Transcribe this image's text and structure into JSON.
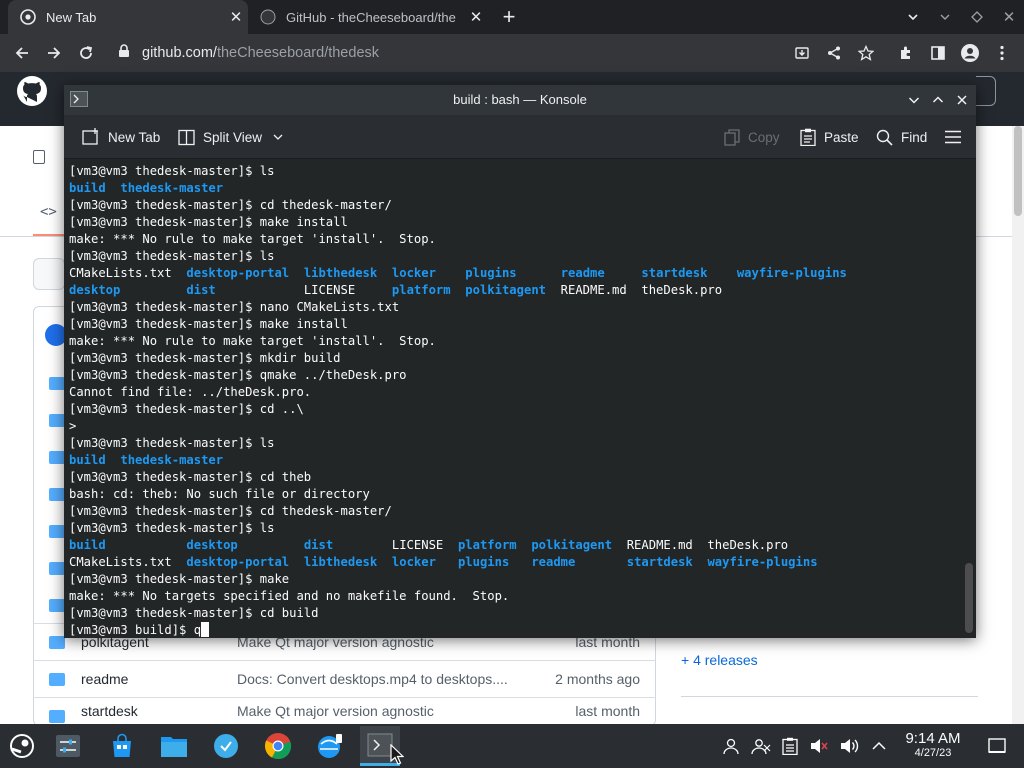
{
  "browser": {
    "tabs": [
      {
        "title": "New Tab",
        "active": true
      },
      {
        "title": "GitHub - theCheeseboard/the",
        "active": false
      }
    ],
    "url_host": "github.com/",
    "url_path": "theCheeseboard/thedesk",
    "new_tab_symbol": "+"
  },
  "github": {
    "files": [
      {
        "name": "polkitagent",
        "message": "Make Qt major version agnostic",
        "time": "last month"
      },
      {
        "name": "readme",
        "message": "Docs: Convert desktops.mp4 to desktops....",
        "time": "2 months ago"
      },
      {
        "name": "startdesk",
        "message": "Make Qt major version agnostic",
        "time": "last month"
      }
    ],
    "releases_link": "+ 4 releases"
  },
  "konsole": {
    "title": "build : bash — Konsole",
    "toolbar": {
      "new_tab": "New Tab",
      "split_view": "Split View",
      "copy": "Copy",
      "paste": "Paste",
      "find": "Find"
    },
    "lines": [
      [
        [
          "[vm3@vm3 thedesk-master]$ ls",
          "n"
        ]
      ],
      [
        [
          "build  ",
          "d"
        ],
        [
          "thedesk-master",
          "d"
        ]
      ],
      [
        [
          "[vm3@vm3 thedesk-master]$ cd thedesk-master/",
          "n"
        ]
      ],
      [
        [
          "[vm3@vm3 thedesk-master]$ make install",
          "n"
        ]
      ],
      [
        [
          "make: *** No rule to make target 'install'.  Stop.",
          "n"
        ]
      ],
      [
        [
          "[vm3@vm3 thedesk-master]$ ls",
          "n"
        ]
      ],
      [
        [
          "CMakeLists.txt  ",
          "n"
        ],
        [
          "desktop-portal",
          "d"
        ],
        [
          "  ",
          "n"
        ],
        [
          "libthedesk",
          "d"
        ],
        [
          "  ",
          "n"
        ],
        [
          "locker",
          "d"
        ],
        [
          "    ",
          "n"
        ],
        [
          "plugins",
          "d"
        ],
        [
          "      ",
          "n"
        ],
        [
          "readme",
          "d"
        ],
        [
          "     ",
          "n"
        ],
        [
          "startdesk",
          "d"
        ],
        [
          "    ",
          "n"
        ],
        [
          "wayfire-plugins",
          "d"
        ]
      ],
      [
        [
          "desktop",
          "d"
        ],
        [
          "         ",
          "n"
        ],
        [
          "dist",
          "d"
        ],
        [
          "            LICENSE     ",
          "n"
        ],
        [
          "platform",
          "d"
        ],
        [
          "  ",
          "n"
        ],
        [
          "polkitagent",
          "d"
        ],
        [
          "  README.md  theDesk.pro",
          "n"
        ]
      ],
      [
        [
          "[vm3@vm3 thedesk-master]$ nano CMakeLists.txt",
          "n"
        ]
      ],
      [
        [
          "[vm3@vm3 thedesk-master]$ make install",
          "n"
        ]
      ],
      [
        [
          "make: *** No rule to make target 'install'.  Stop.",
          "n"
        ]
      ],
      [
        [
          "[vm3@vm3 thedesk-master]$ mkdir build",
          "n"
        ]
      ],
      [
        [
          "[vm3@vm3 thedesk-master]$ qmake ../theDesk.pro",
          "n"
        ]
      ],
      [
        [
          "Cannot find file: ../theDesk.pro.",
          "n"
        ]
      ],
      [
        [
          "[vm3@vm3 thedesk-master]$ cd ..\\",
          "n"
        ]
      ],
      [
        [
          ">",
          "n"
        ]
      ],
      [
        [
          "[vm3@vm3 thedesk-master]$ ls",
          "n"
        ]
      ],
      [
        [
          "build  ",
          "d"
        ],
        [
          "thedesk-master",
          "d"
        ]
      ],
      [
        [
          "[vm3@vm3 thedesk-master]$ cd theb",
          "n"
        ]
      ],
      [
        [
          "bash: cd: theb: No such file or directory",
          "n"
        ]
      ],
      [
        [
          "[vm3@vm3 thedesk-master]$ cd thedesk-master/",
          "n"
        ]
      ],
      [
        [
          "[vm3@vm3 thedesk-master]$ ls",
          "n"
        ]
      ],
      [
        [
          "build",
          "d"
        ],
        [
          "           ",
          "n"
        ],
        [
          "desktop",
          "d"
        ],
        [
          "         ",
          "n"
        ],
        [
          "dist",
          "d"
        ],
        [
          "        LICENSE  ",
          "n"
        ],
        [
          "platform",
          "d"
        ],
        [
          "  ",
          "n"
        ],
        [
          "polkitagent",
          "d"
        ],
        [
          "  README.md  theDesk.pro",
          "n"
        ]
      ],
      [
        [
          "CMakeLists.txt  ",
          "n"
        ],
        [
          "desktop-portal",
          "d"
        ],
        [
          "  ",
          "n"
        ],
        [
          "libthedesk",
          "d"
        ],
        [
          "  ",
          "n"
        ],
        [
          "locker",
          "d"
        ],
        [
          "   ",
          "n"
        ],
        [
          "plugins",
          "d"
        ],
        [
          "   ",
          "n"
        ],
        [
          "readme",
          "d"
        ],
        [
          "       ",
          "n"
        ],
        [
          "startdesk",
          "d"
        ],
        [
          "  ",
          "n"
        ],
        [
          "wayfire-plugins",
          "d"
        ]
      ],
      [
        [
          "[vm3@vm3 thedesk-master]$ make",
          "n"
        ]
      ],
      [
        [
          "make: *** No targets specified and no makefile found.  Stop.",
          "n"
        ]
      ],
      [
        [
          "[vm3@vm3 thedesk-master]$ cd build",
          "n"
        ]
      ],
      [
        [
          "[vm3@vm3 build]$ q",
          "n"
        ]
      ]
    ]
  },
  "taskbar": {
    "time": "9:14 AM",
    "date": "4/27/23"
  },
  "colors": {
    "terminal_bg": "#232627",
    "terminal_fg": "#fcfcfc",
    "directory": "#1d99f3",
    "chrome_dark": "#202124",
    "taskbar_bg": "#2a2e32"
  }
}
